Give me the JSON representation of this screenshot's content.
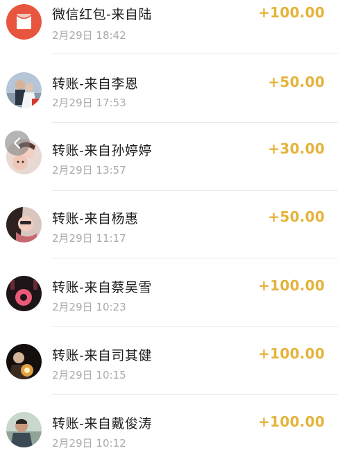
{
  "transactions": [
    {
      "title": "微信红包-来自陆",
      "time": "2月29日 18:42",
      "amount": "+100.00",
      "avatar": "red-packet-icon"
    },
    {
      "title": "转账-来自李恩",
      "time": "2月29日 17:53",
      "amount": "+50.00",
      "avatar": "user-avatar"
    },
    {
      "title": "转账-来自孙婷婷",
      "time": "2月29日 13:57",
      "amount": "+30.00",
      "avatar": "user-avatar"
    },
    {
      "title": "转账-来自杨惠",
      "time": "2月29日 11:17",
      "amount": "+50.00",
      "avatar": "user-avatar"
    },
    {
      "title": "转账-来自蔡吴雪",
      "time": "2月29日 10:23",
      "amount": "+100.00",
      "avatar": "user-avatar"
    },
    {
      "title": "转账-来自司其健",
      "time": "2月29日 10:15",
      "amount": "+100.00",
      "avatar": "user-avatar"
    },
    {
      "title": "转账-来自戴俊涛",
      "time": "2月29日 10:12",
      "amount": "+100.00",
      "avatar": "user-avatar"
    }
  ],
  "colors": {
    "amount": "#e4b33a",
    "title": "#1f1f1f",
    "time": "#a9a9a9",
    "red_packet": "#e8553e"
  },
  "icons": {
    "back": "chevron-left-icon"
  }
}
